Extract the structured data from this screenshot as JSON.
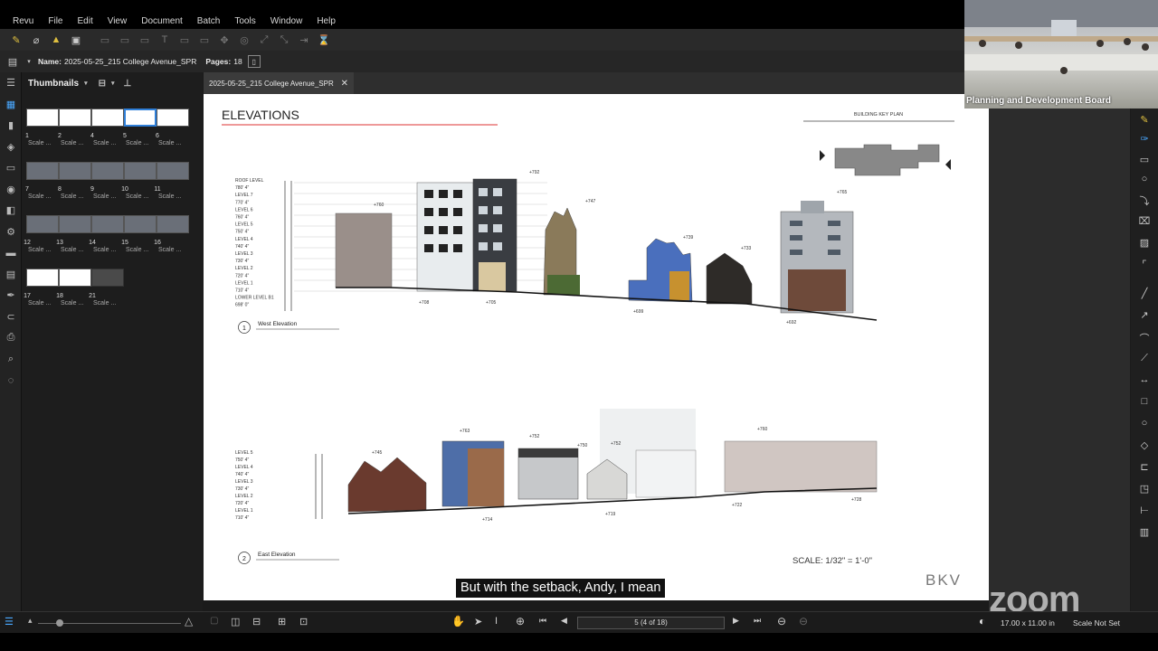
{
  "menu": [
    "Revu",
    "File",
    "Edit",
    "View",
    "Document",
    "Batch",
    "Tools",
    "Window",
    "Help"
  ],
  "docbar": {
    "name_label": "Name:",
    "name_value": "2025-05-25_215 College Avenue_SPR",
    "pages_label": "Pages:",
    "pages_value": "18"
  },
  "thumbnails": {
    "title": "Thumbnails",
    "items": [
      {
        "num": "1",
        "scale": "Scale ..."
      },
      {
        "num": "2",
        "scale": "Scale ..."
      },
      {
        "num": "4",
        "scale": "Scale ..."
      },
      {
        "num": "5",
        "scale": "Scale ..."
      },
      {
        "num": "6",
        "scale": "Scale ..."
      },
      {
        "num": "7",
        "scale": "Scale ..."
      },
      {
        "num": "8",
        "scale": "Scale ..."
      },
      {
        "num": "9",
        "scale": "Scale ..."
      },
      {
        "num": "10",
        "scale": "Scale ..."
      },
      {
        "num": "11",
        "scale": "Scale ..."
      },
      {
        "num": "12",
        "scale": "Scale ..."
      },
      {
        "num": "13",
        "scale": "Scale ..."
      },
      {
        "num": "14",
        "scale": "Scale ..."
      },
      {
        "num": "15",
        "scale": "Scale ..."
      },
      {
        "num": "16",
        "scale": "Scale ..."
      },
      {
        "num": "17",
        "scale": "Scale ..."
      },
      {
        "num": "18",
        "scale": "Scale ..."
      },
      {
        "num": "21",
        "scale": "Scale ..."
      }
    ]
  },
  "tab": {
    "label": "2025-05-25_215 College Avenue_SPR"
  },
  "drawing": {
    "title": "ELEVATIONS",
    "key_plan": "BUILDING KEY PLAN",
    "west_num": "1",
    "west_label": "West Elevation",
    "east_num": "2",
    "east_label": "East Elevation",
    "scale": "SCALE: 1/32\" = 1'-0\"",
    "brand": "BKV",
    "west_levels": [
      "ROOF LEVEL",
      "780' 4\"",
      "LEVEL 7",
      "770' 4\"",
      "LEVEL 6",
      "760' 4\"",
      "LEVEL 5",
      "750' 4\"",
      "LEVEL 4",
      "740' 4\"",
      "LEVEL 3",
      "730' 4\"",
      "LEVEL 2",
      "720' 4\"",
      "LEVEL 1",
      "710' 4\"",
      "LOWER LEVEL B1",
      "698' 0\""
    ],
    "east_levels": [
      "LEVEL 5",
      "750' 4\"",
      "LEVEL 4",
      "740' 4\"",
      "LEVEL 3",
      "730' 4\"",
      "LEVEL 2",
      "720' 4\"",
      "LEVEL 1",
      "710' 4\""
    ],
    "west_marks": [
      "+760",
      "+792",
      "+747",
      "+739",
      "+733",
      "+765",
      "+708",
      "+705",
      "+699",
      "+692"
    ],
    "east_marks": [
      "+745",
      "+763",
      "+752",
      "+750",
      "+752",
      "+760",
      "+714",
      "+719",
      "+722",
      "+728"
    ]
  },
  "zoom": {
    "participant_label": "Planning and Development Board",
    "watermark": "zoom"
  },
  "caption": "But with the setback, Andy, I mean",
  "status": {
    "page_field": "5 (4 of 18)",
    "dimensions": "17.00 x 11.00 in",
    "scale": "Scale Not Set"
  }
}
